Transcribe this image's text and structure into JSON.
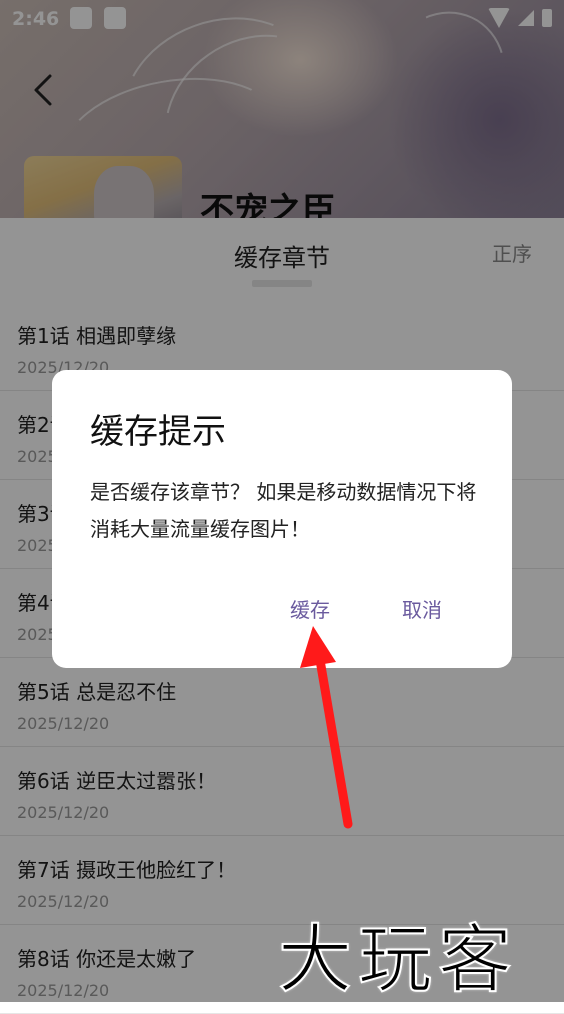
{
  "status_bar": {
    "time": "2:46"
  },
  "header": {
    "manga_title": "不宠之臣"
  },
  "sheet": {
    "title": "缓存章节",
    "sort_label": "正序",
    "chapters": [
      {
        "title": "第1话 相遇即孽缘",
        "date": "2025/12/20"
      },
      {
        "title": "第2话",
        "date": "2025/12/20"
      },
      {
        "title": "第3话",
        "date": "2025/12/20"
      },
      {
        "title": "第4话",
        "date": "2025/12/20"
      },
      {
        "title": "第5话 总是忍不住",
        "date": "2025/12/20"
      },
      {
        "title": "第6话 逆臣太过嚣张！",
        "date": "2025/12/20"
      },
      {
        "title": "第7话 摄政王他脸红了！",
        "date": "2025/12/20"
      },
      {
        "title": "第8话 你还是太嫩了",
        "date": "2025/12/20"
      }
    ]
  },
  "dialog": {
    "title": "缓存提示",
    "message": "是否缓存该章节？ 如果是移动数据情况下将消耗大量流量缓存图片！",
    "confirm_label": "缓存",
    "cancel_label": "取消"
  },
  "watermark": "大玩客",
  "colors": {
    "accent": "#6a5a9e",
    "arrow": "#ff1a1a"
  },
  "icons": {
    "back": "chevron-left-icon"
  }
}
